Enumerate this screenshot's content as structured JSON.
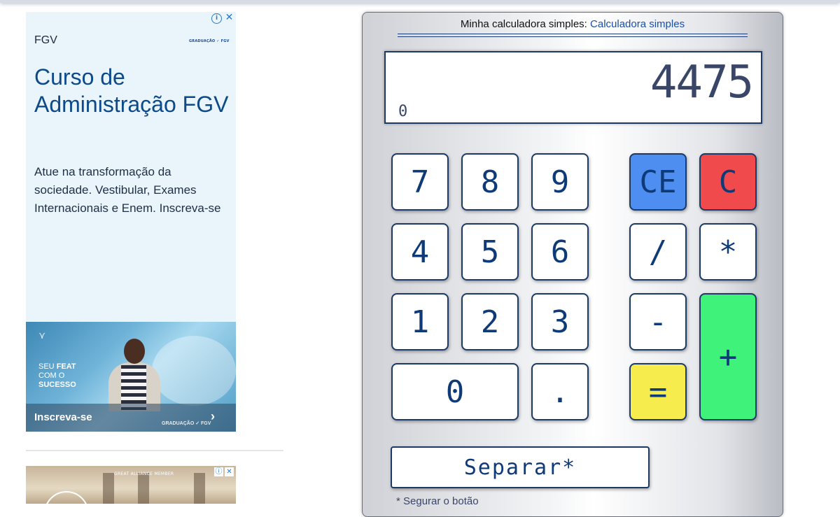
{
  "ad_top": {
    "brand": "FGV",
    "logo_small": "GRADUAÇÃO ✓ FGV",
    "headline": "Curso de Administração FGV",
    "body": "Atue na transformação da sociedade. Vestibular, Exames Internacionais e Enem. Inscreva-se",
    "image_slogan_1": "SEU",
    "image_slogan_bold": "FEAT",
    "image_slogan_2": "COM O",
    "image_slogan_3": "SUCESSO",
    "cta": "Inscreva-se",
    "cta_logo": "GRADUAÇÃO ✓ FGV"
  },
  "ad_bottom": {
    "badge": "GREAT ALLIANCE MEMBER"
  },
  "calculator": {
    "title_text": "Minha calculadora simples: ",
    "title_link": "Calculadora simples",
    "display_main": "4475",
    "display_sub": "0",
    "keys": {
      "k7": "7",
      "k8": "8",
      "k9": "9",
      "k4": "4",
      "k5": "5",
      "k6": "6",
      "k1": "1",
      "k2": "2",
      "k3": "3",
      "k0": "0",
      "dot": ".",
      "ce": "CE",
      "c": "C",
      "div": "/",
      "mul": "*",
      "minus": "-",
      "plus": "+",
      "eq": "="
    },
    "separate_button": "Separar*",
    "footnote": "* Segurar o botão"
  },
  "colors": {
    "ce": "#4e8ef1",
    "c": "#f04a4c",
    "eq": "#f6ec4e",
    "plus": "#3ff27a",
    "key_text": "#0f3a78",
    "display_text": "#3a4668"
  }
}
